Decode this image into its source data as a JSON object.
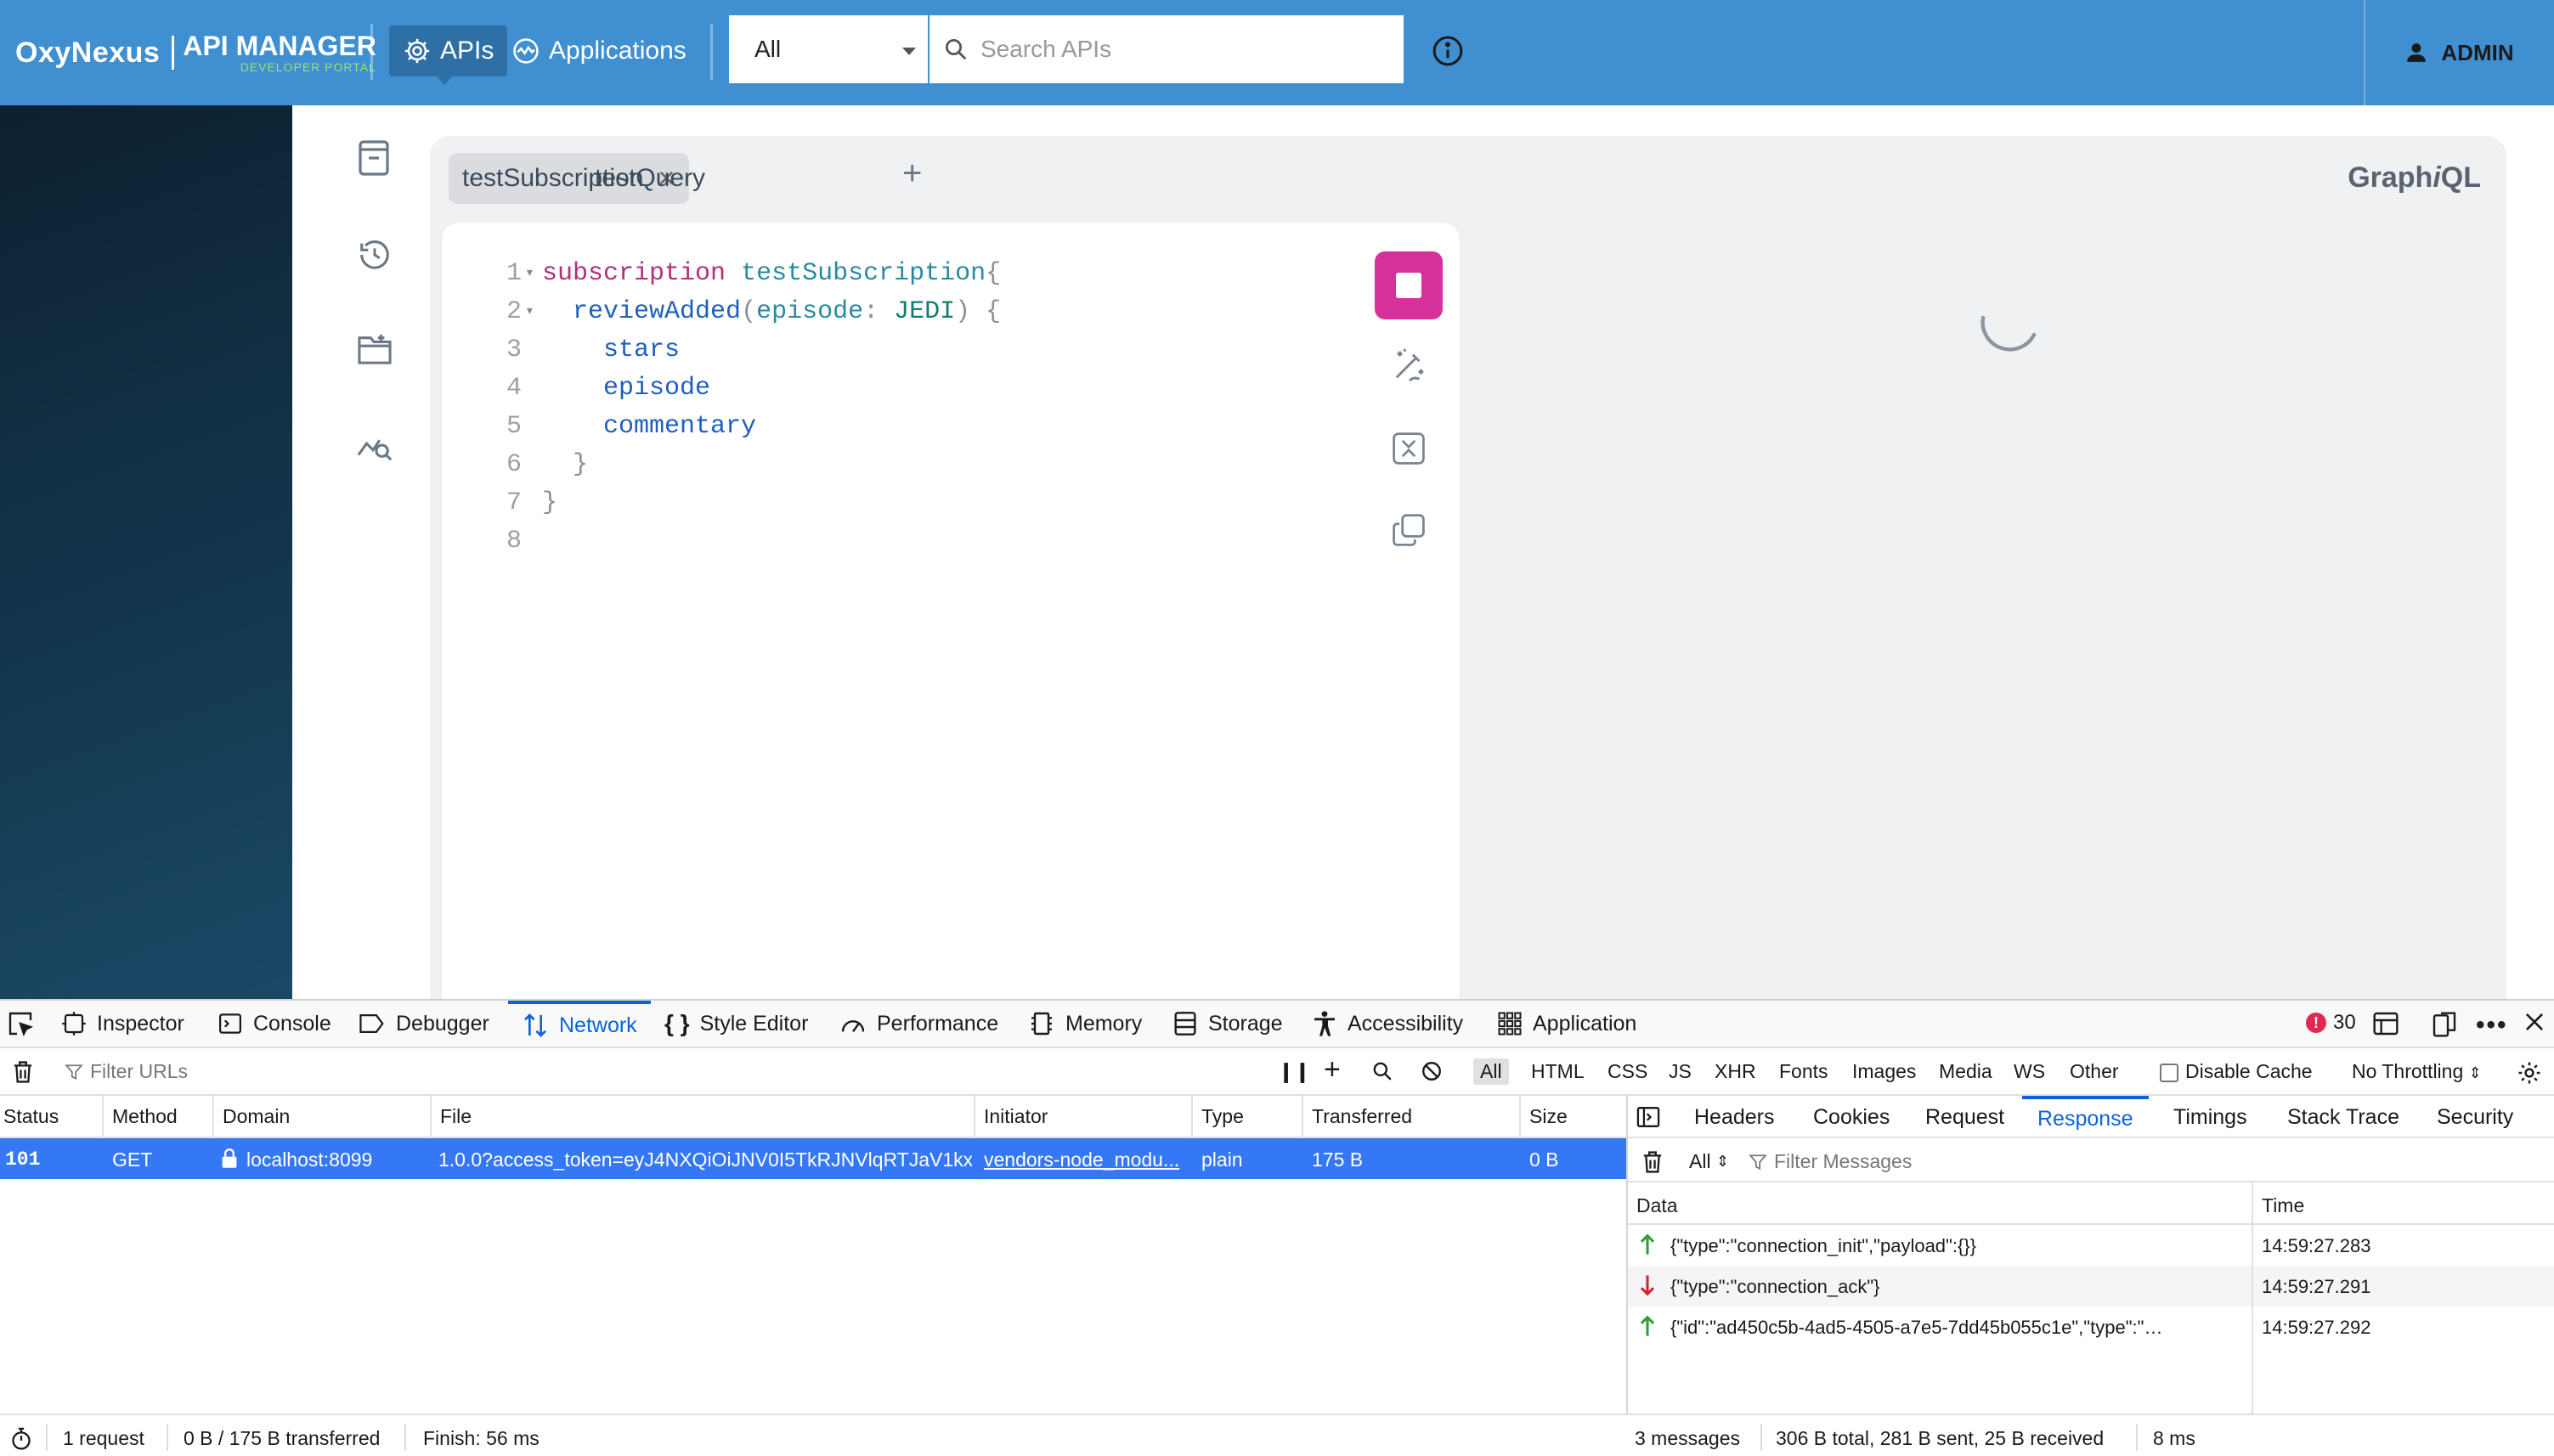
{
  "header": {
    "brand": "OxyNexus",
    "product_title": "API MANAGER",
    "product_subtitle": "DEVELOPER PORTAL",
    "nav": {
      "apis": "APIs",
      "applications": "Applications"
    },
    "filter_select": "All",
    "search_placeholder": "Search APIs",
    "user": "ADMIN"
  },
  "graphiql": {
    "title_prefix": "Graph",
    "title_italic": "i",
    "title_suffix": "QL",
    "tabs": [
      {
        "label": "testSubscription",
        "active": true
      },
      {
        "label": "testQuery",
        "active": false
      }
    ],
    "line_numbers": [
      "1",
      "2",
      "3",
      "4",
      "5",
      "6",
      "7",
      "8"
    ],
    "code": {
      "l1_kw": "subscription",
      "l1_name": "testSubscription",
      "l1_punc": "{",
      "l2_field": "reviewAdded",
      "l2_p1": "(",
      "l2_arg": "episode",
      "l2_colon": ":",
      "l2_enum": "JEDI",
      "l2_p2": ") {",
      "l3_field": "stars",
      "l4_field": "episode",
      "l5_field": "commentary",
      "l6_punc": "}",
      "l7_punc": "}"
    }
  },
  "devtools": {
    "tabs": [
      "Inspector",
      "Console",
      "Debugger",
      "Network",
      "Style Editor",
      "Performance",
      "Memory",
      "Storage",
      "Accessibility",
      "Application"
    ],
    "active_tab": "Network",
    "error_count": "30",
    "filter_urls_placeholder": "Filter URLs",
    "type_filters": [
      "All",
      "HTML",
      "CSS",
      "JS",
      "XHR",
      "Fonts",
      "Images",
      "Media",
      "WS",
      "Other"
    ],
    "disable_cache": "Disable Cache",
    "throttling": "No Throttling",
    "columns": [
      "Status",
      "Method",
      "Domain",
      "File",
      "Initiator",
      "Type",
      "Transferred",
      "Size"
    ],
    "request": {
      "status": "101",
      "method": "GET",
      "domain": "localhost:8099",
      "file": "1.0.0?access_token=eyJ4NXQiOiJNV0I5TkRJNVlqRTJaV1kx",
      "initiator": "vendors-node_modu...",
      "type": "plain",
      "transferred": "175 B",
      "size": "0 B"
    },
    "detail_tabs": [
      "Headers",
      "Cookies",
      "Request",
      "Response",
      "Timings",
      "Stack Trace",
      "Security"
    ],
    "active_detail_tab": "Response",
    "msg_filter_all": "All",
    "msg_filter_placeholder": "Filter Messages",
    "msg_columns": [
      "Data",
      "Time"
    ],
    "messages": [
      {
        "direction": "sent",
        "data": "{\"type\":\"connection_init\",\"payload\":{}}",
        "time": "14:59:27.283"
      },
      {
        "direction": "received",
        "data": "{\"type\":\"connection_ack\"}",
        "time": "14:59:27.291"
      },
      {
        "direction": "sent",
        "data": "{\"id\":\"ad450c5b-4ad5-4505-a7e5-7dd45b055c1e\",\"type\":\"su...",
        "time": "14:59:27.292"
      }
    ],
    "status_bar": {
      "requests": "1 request",
      "transferred": "0 B / 175 B transferred",
      "finish": "Finish: 56 ms",
      "messages": "3 messages",
      "totals": "306 B total, 281 B sent, 25 B received",
      "duration": "8 ms"
    }
  }
}
